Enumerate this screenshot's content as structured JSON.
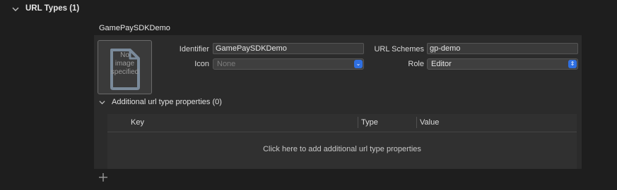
{
  "section": {
    "title": "URL Types (1)"
  },
  "entry": {
    "name": "GamePaySDKDemo",
    "image_placeholder": [
      "No",
      "image",
      "specified"
    ],
    "identifier_label": "Identifier",
    "identifier_value": "GamePaySDKDemo",
    "icon_label": "Icon",
    "icon_value": "None",
    "url_schemes_label": "URL Schemes",
    "url_schemes_value": "gp-demo",
    "role_label": "Role",
    "role_value": "Editor"
  },
  "additional": {
    "title": "Additional url type properties (0)",
    "columns": [
      "Key",
      "Type",
      "Value"
    ],
    "empty_hint": "Click here to add additional url type properties"
  },
  "colors": {
    "accent": "#2f6fe0",
    "background": "#1e1e1e",
    "panel": "#2b2b2b"
  },
  "icons": [
    "chevron-down-icon",
    "document-icon",
    "popup-arrows-icon",
    "plus-icon"
  ]
}
